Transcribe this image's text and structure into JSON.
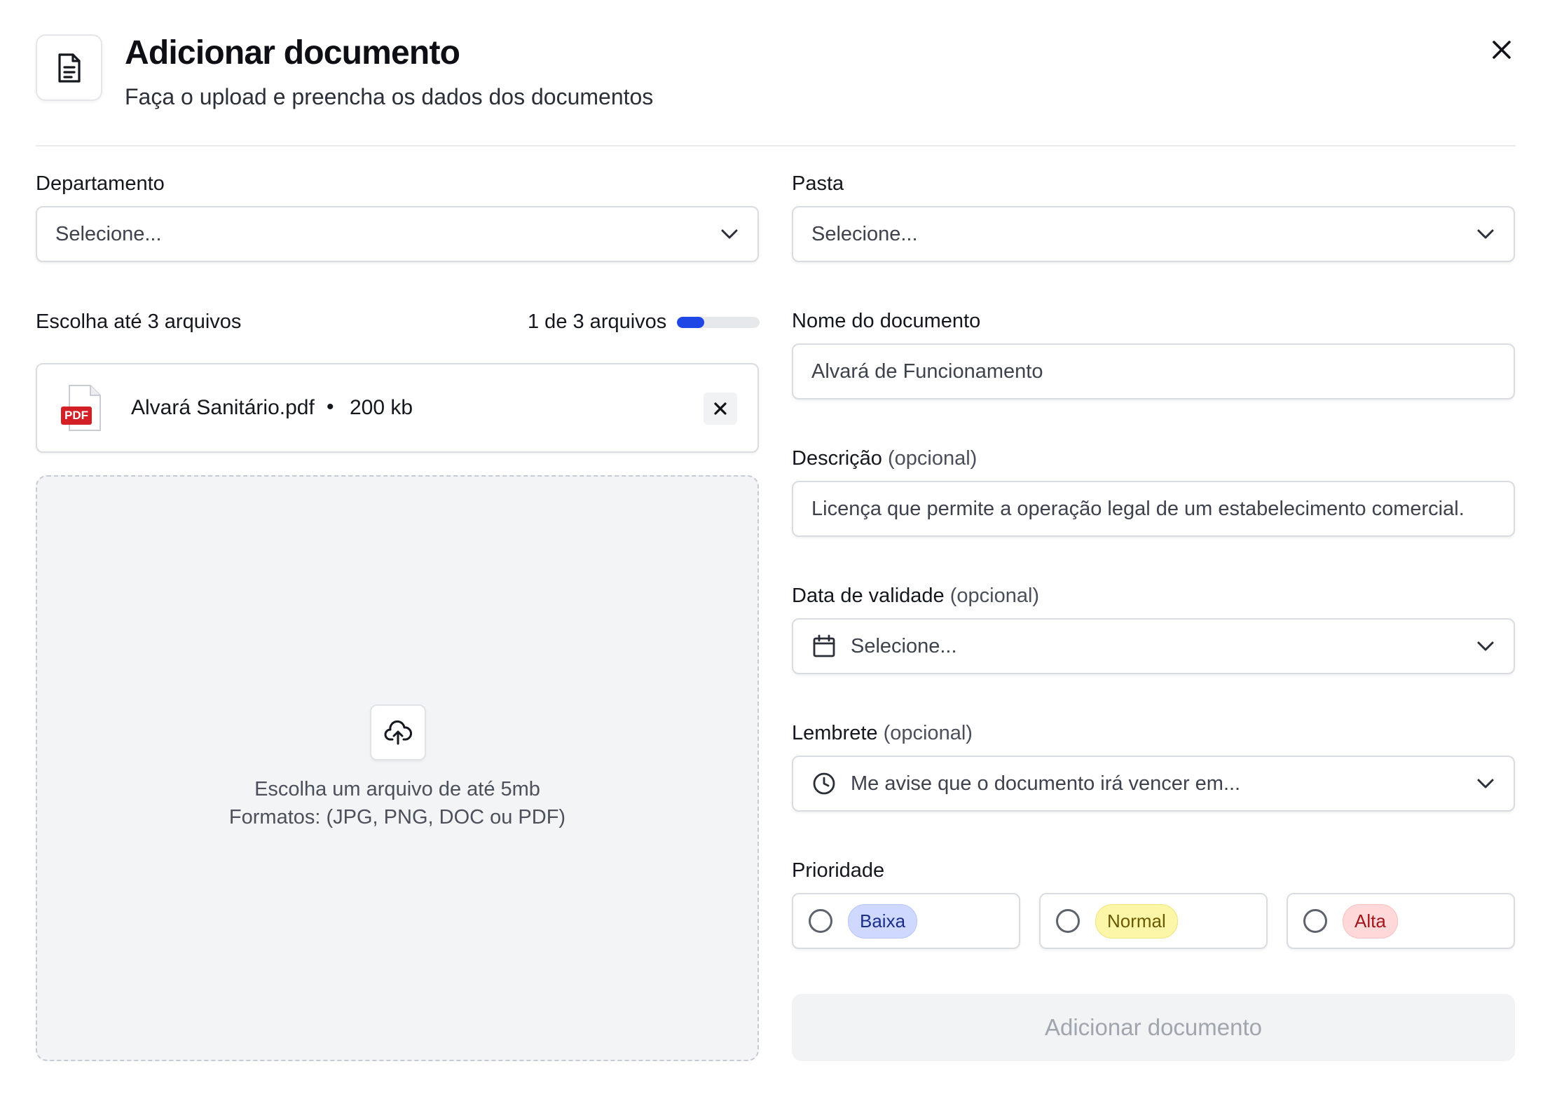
{
  "header": {
    "title": "Adicionar documento",
    "subtitle": "Faça o upload e preencha os dados dos documentos",
    "icon": "document-icon",
    "close_icon": "close-icon"
  },
  "departamento": {
    "label": "Departamento",
    "placeholder": "Selecione..."
  },
  "pasta": {
    "label": "Pasta",
    "placeholder": "Selecione..."
  },
  "files": {
    "label": "Escolha até 3 arquivos",
    "counter": "1 de 3 arquivos",
    "progress": 0.333,
    "items": [
      {
        "icon_label": "PDF",
        "name": "Alvará Sanitário.pdf",
        "separator": "•",
        "size": "200 kb"
      }
    ]
  },
  "dropzone": {
    "line1": "Escolha um arquivo de até 5mb",
    "line2": "Formatos: (JPG, PNG, DOC ou PDF)",
    "icon": "cloud-upload-icon"
  },
  "nome": {
    "label": "Nome do documento",
    "value": "Alvará de Funcionamento"
  },
  "descricao": {
    "label": "Descrição",
    "optional": "(opcional)",
    "value": "Licença que permite a operação legal de um estabelecimento comercial."
  },
  "validade": {
    "label": "Data de validade",
    "optional": "(opcional)",
    "placeholder": "Selecione...",
    "icon": "calendar-icon"
  },
  "lembrete": {
    "label": "Lembrete",
    "optional": "(opcional)",
    "placeholder": "Me avise que o documento irá vencer em...",
    "icon": "clock-icon"
  },
  "prioridade": {
    "label": "Prioridade",
    "options": [
      {
        "label": "Baixa",
        "color": "#cfd9ff"
      },
      {
        "label": "Normal",
        "color": "#fcf6a8"
      },
      {
        "label": "Alta",
        "color": "#ffd9d9"
      }
    ]
  },
  "submit": {
    "label": "Adicionar documento"
  },
  "colors": {
    "accent": "#1f47e6"
  }
}
